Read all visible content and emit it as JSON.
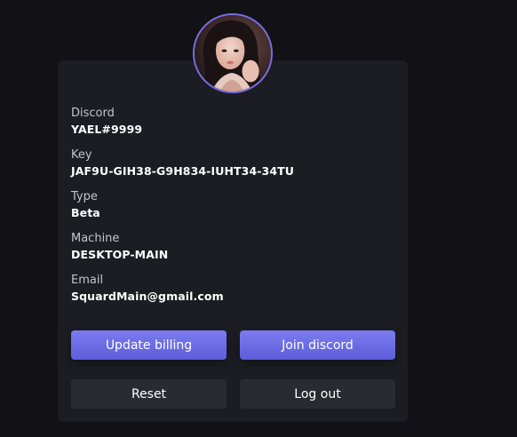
{
  "profile": {
    "avatar_icon": "user-avatar-photo",
    "accent_color": "#7b6de3"
  },
  "fields": [
    {
      "label": "Discord",
      "value": "YAEL#9999"
    },
    {
      "label": "Key",
      "value": "JAF9U-GIH38-G9H834-IUHT34-34TU"
    },
    {
      "label": "Type",
      "value": "Beta"
    },
    {
      "label": "Machine",
      "value": "DESKTOP-MAIN"
    },
    {
      "label": "Email",
      "value": "SquardMain@gmail.com"
    }
  ],
  "actions": {
    "update_billing": "Update billing",
    "join_discord": "Join discord",
    "reset": "Reset",
    "log_out": "Log out"
  },
  "colors": {
    "background": "#121116",
    "card": "#1c1d23",
    "primary_button": "#6d6ee6",
    "secondary_button": "#2a2b31"
  }
}
